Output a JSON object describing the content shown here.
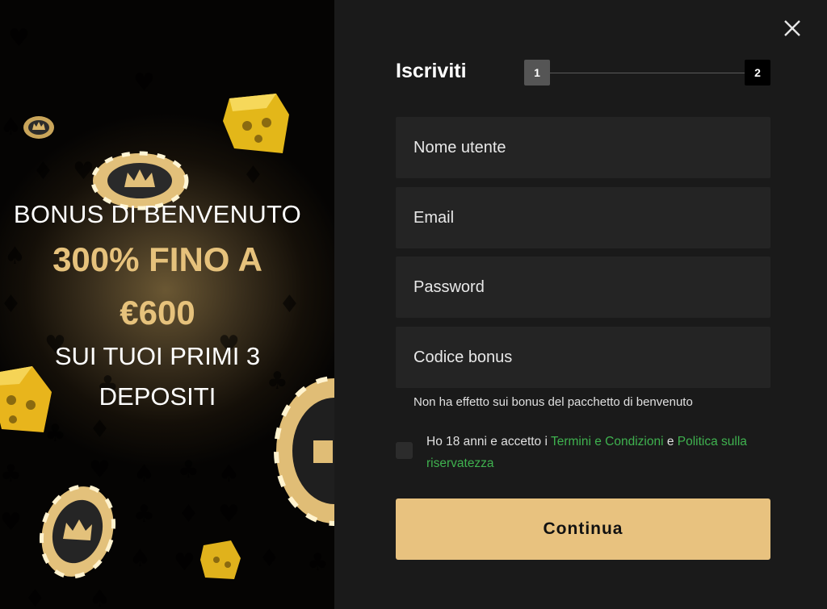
{
  "promo": {
    "line1": "BONUS DI BENVENUTO",
    "line2": "300% FINO A",
    "line3": "€600",
    "line4": "SUI TUOI PRIMI 3",
    "line5": "DEPOSITI"
  },
  "form": {
    "title": "Iscriviti",
    "steps": [
      "1",
      "2"
    ],
    "fields": {
      "username_placeholder": "Nome utente",
      "email_placeholder": "Email",
      "password_placeholder": "Password",
      "bonus_placeholder": "Codice bonus"
    },
    "bonus_hint": "Non ha effetto sui bonus del pacchetto di benvenuto",
    "consent": {
      "prefix": "Ho 18 anni e accetto i ",
      "terms_link": "Termini e Condizioni",
      "middle": " e ",
      "privacy_link": "Politica sulla riservatezza"
    },
    "continue_label": "Continua"
  },
  "icons": {
    "close": "close-icon",
    "dice": "dice-icon",
    "chip": "casino-chip-icon"
  },
  "colors": {
    "accent_gold": "#e8c27f",
    "link_green": "#3fb24f",
    "panel_bg": "#1a1a1a",
    "field_bg": "#242424"
  }
}
